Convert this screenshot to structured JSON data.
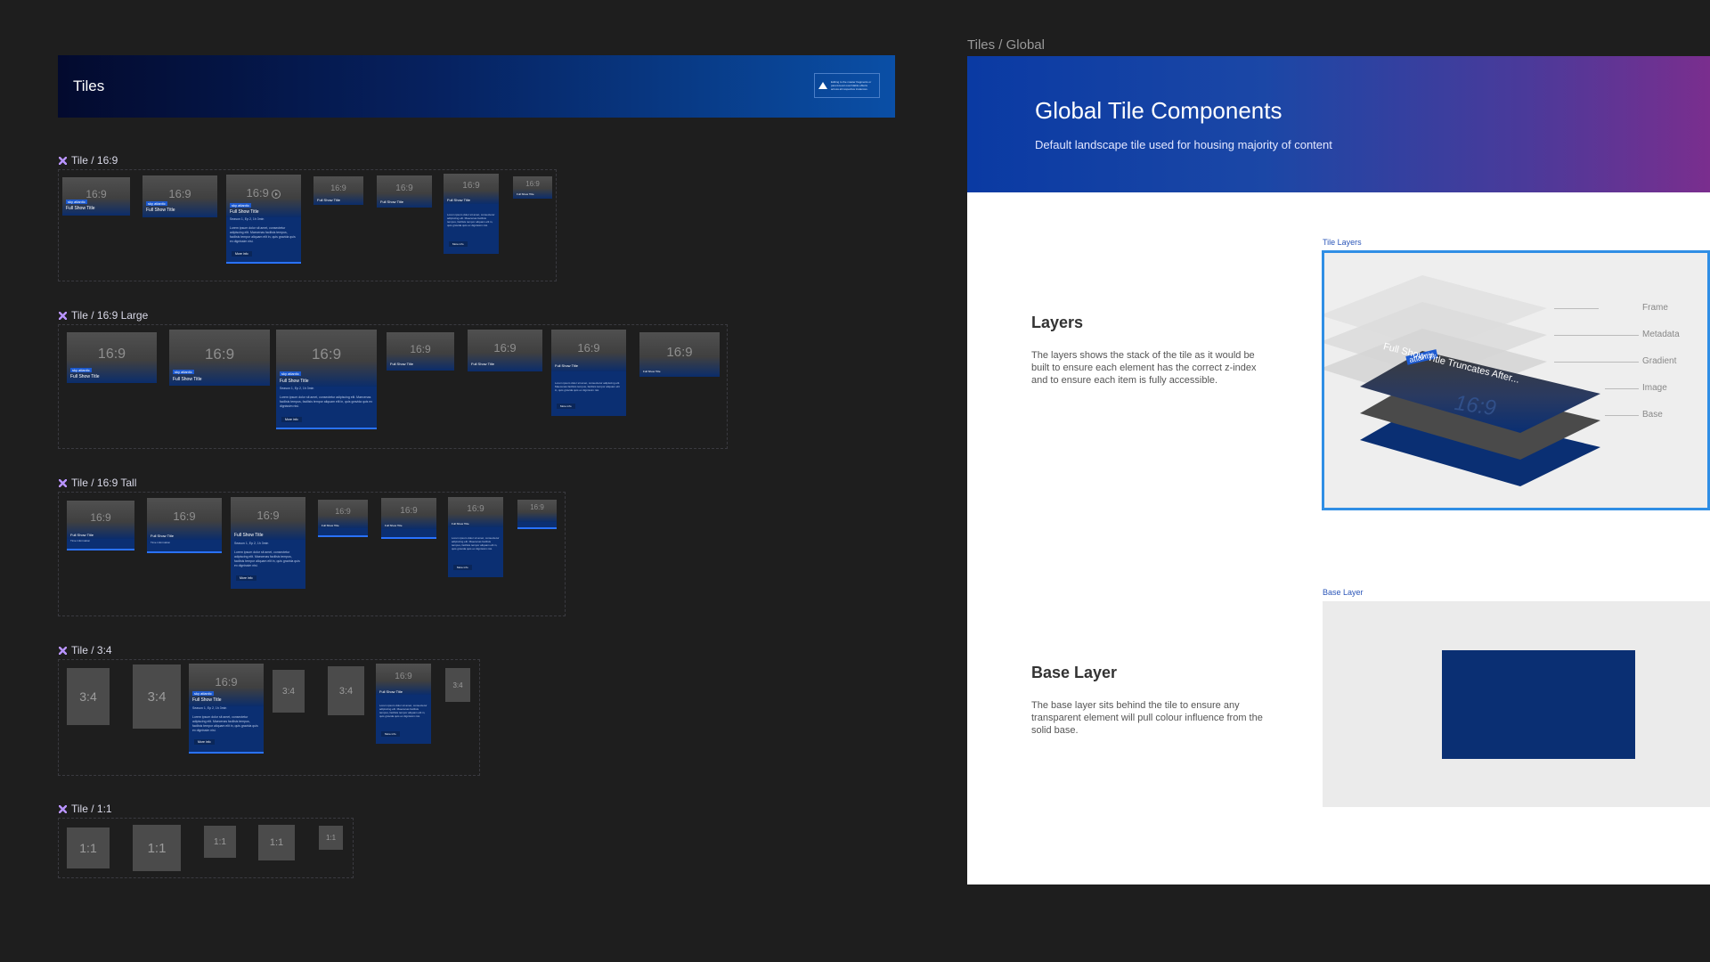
{
  "left": {
    "header": {
      "title": "Tiles",
      "warning": "Editing to the master fragments or parent-level overridable effects across all respective instances."
    },
    "sections": [
      {
        "label": "Tile / 16:9"
      },
      {
        "label": "Tile / 16:9 Large"
      },
      {
        "label": "Tile / 16:9 Tall"
      },
      {
        "label": "Tile / 3:4"
      },
      {
        "label": "Tile / 1:1"
      }
    ],
    "tile_text": {
      "ratio_169": "16:9",
      "ratio_34": "3:4",
      "ratio_11": "1:1",
      "chip": "sky atlantic",
      "show_title": "Full Show Title",
      "time_info": "Time information",
      "episode": "Season 1, Ep 2, 1h 3min",
      "desc": "Lorem ipsum dolor sit amet, consectetur adipiscing elit. Maecenas facilisis tempus, facilisis tempor aliquam elit in, quis gravida quis ex dignissim nisi.",
      "more": "More info"
    }
  },
  "right": {
    "panel_label": "Tiles / Global",
    "hero": {
      "title": "Global Tile Components",
      "subtitle": "Default landscape tile used for housing majority of content"
    },
    "layers": {
      "heading": "Layers",
      "body": "The layers shows the stack of the tile as it would be built to ensure each element has the correct z-index and to ensure each item is fully accessible.",
      "caption": "Tile Layers",
      "labels": [
        "Frame",
        "Metadata",
        "Gradient",
        "Image",
        "Base"
      ],
      "demo_chip": "atlantic",
      "demo_title": "Full Show Title Truncates After...",
      "demo_ratio": "16:9"
    },
    "base": {
      "heading": "Base Layer",
      "body": "The base layer sits behind the tile to ensure any transparent element will pull colour influence from the solid base.",
      "caption": "Base Layer",
      "base_color": "#0a2f73"
    }
  },
  "colors": {
    "background": "#1e1e1e",
    "accent": "#2a72ff",
    "component": "#b792ff",
    "base": "#0a2f73"
  }
}
